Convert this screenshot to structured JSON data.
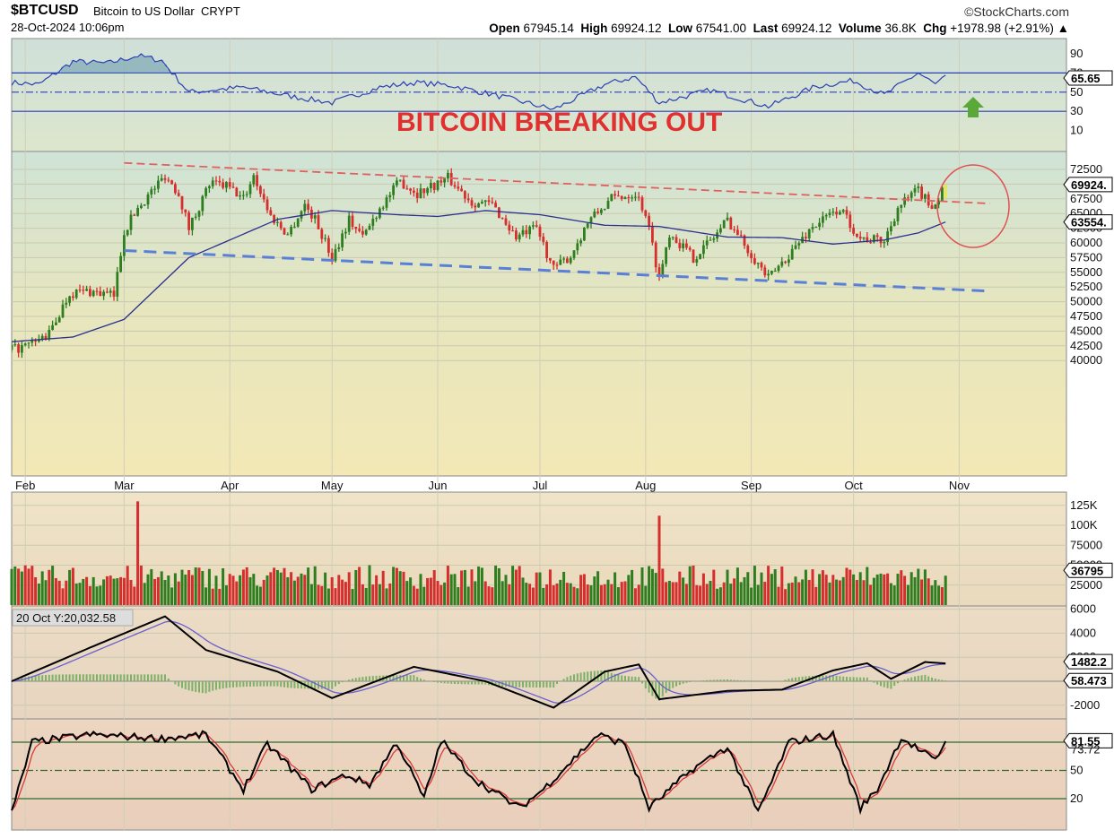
{
  "header": {
    "symbol": "$BTCUSD",
    "name": "Bitcoin to US Dollar",
    "exchange": "CRYPT",
    "datetime": "28-Oct-2024 10:06pm",
    "copyright": "©StockCharts.com",
    "open_label": "Open",
    "open": "67945.14",
    "high_label": "High",
    "high": "69924.12",
    "low_label": "Low",
    "low": "67541.00",
    "last_label": "Last",
    "last": "69924.12",
    "volume_label": "Volume",
    "volume": "36.8K",
    "chg_label": "Chg",
    "chg": "+1978.98 (+2.91%)",
    "chg_arrow": "▲"
  },
  "annotation": "BITCOIN BREAKING OUT",
  "colors": {
    "up": "#2e7d1f",
    "down": "#d62d2d",
    "ma": "#2b2f8f",
    "resistance": "#e06060",
    "support": "#5a7fd6",
    "annotation": "#e03030",
    "circle": "#e05050",
    "arrow": "#5aa83a"
  },
  "months": [
    "Feb",
    "Mar",
    "Apr",
    "May",
    "Jun",
    "Jul",
    "Aug",
    "Sep",
    "Oct",
    "Nov"
  ],
  "rsi_panel": {
    "ticks": [
      "90",
      "70",
      "50",
      "30",
      "10"
    ],
    "value_label": "65.65"
  },
  "price_panel": {
    "ticks": [
      "72500",
      "70000",
      "67500",
      "65000",
      "62500",
      "60000",
      "57500",
      "55000",
      "52500",
      "50000",
      "47500",
      "45000",
      "42500",
      "40000"
    ],
    "last_label": "69924.",
    "ma_label": "63554."
  },
  "volume_panel": {
    "ticks": [
      "125K",
      "100K",
      "75000",
      "50000",
      "25000"
    ],
    "value_label": "36795"
  },
  "macd_panel": {
    "info": "20 Oct Y:20,032.58",
    "ticks": [
      "6000",
      "4000",
      "2000",
      "-2000"
    ],
    "macd_label": "1482.2",
    "hist_label": "58.473"
  },
  "stoch_panel": {
    "ticks": [
      "80",
      "50",
      "20"
    ],
    "k_label": "81.55",
    "d_label": "73.72"
  },
  "chart_data": {
    "type": "line",
    "title": "$BTCUSD Bitcoin to US Dollar CRYPT",
    "x_range": [
      "2024-01-28",
      "2024-10-28"
    ],
    "price_anchors": [
      [
        "2024-01-28",
        41800
      ],
      [
        "2024-02-02",
        42500
      ],
      [
        "2024-02-08",
        44500
      ],
      [
        "2024-02-14",
        51500
      ],
      [
        "2024-02-20",
        51800
      ],
      [
        "2024-02-27",
        51000
      ],
      [
        "2024-03-01",
        62000
      ],
      [
        "2024-03-05",
        66000
      ],
      [
        "2024-03-08",
        68000
      ],
      [
        "2024-03-13",
        71500
      ],
      [
        "2024-03-17",
        68500
      ],
      [
        "2024-03-20",
        62500
      ],
      [
        "2024-03-26",
        70000
      ],
      [
        "2024-03-31",
        69700
      ],
      [
        "2024-04-05",
        67500
      ],
      [
        "2024-04-08",
        71500
      ],
      [
        "2024-04-13",
        64500
      ],
      [
        "2024-04-18",
        61500
      ],
      [
        "2024-04-23",
        66500
      ],
      [
        "2024-04-26",
        64000
      ],
      [
        "2024-05-01",
        57500
      ],
      [
        "2024-05-06",
        64000
      ],
      [
        "2024-05-10",
        61000
      ],
      [
        "2024-05-15",
        66000
      ],
      [
        "2024-05-21",
        70500
      ],
      [
        "2024-05-26",
        68500
      ],
      [
        "2024-06-04",
        71000
      ],
      [
        "2024-06-11",
        67000
      ],
      [
        "2024-06-17",
        66500
      ],
      [
        "2024-06-24",
        61000
      ],
      [
        "2024-06-30",
        62500
      ],
      [
        "2024-07-05",
        55500
      ],
      [
        "2024-07-10",
        57800
      ],
      [
        "2024-07-15",
        63500
      ],
      [
        "2024-07-22",
        67500
      ],
      [
        "2024-07-29",
        68500
      ],
      [
        "2024-08-01",
        65000
      ],
      [
        "2024-08-05",
        54000
      ],
      [
        "2024-08-08",
        61800
      ],
      [
        "2024-08-15",
        57500
      ],
      [
        "2024-08-21",
        61000
      ],
      [
        "2024-08-25",
        64000
      ],
      [
        "2024-08-31",
        59000
      ],
      [
        "2024-09-06",
        53900
      ],
      [
        "2024-09-12",
        58000
      ],
      [
        "2024-09-19",
        62800
      ],
      [
        "2024-09-27",
        65800
      ],
      [
        "2024-10-03",
        60800
      ],
      [
        "2024-10-10",
        60300
      ],
      [
        "2024-10-14",
        66000
      ],
      [
        "2024-10-20",
        69000
      ],
      [
        "2024-10-23",
        66700
      ],
      [
        "2024-10-25",
        66600
      ],
      [
        "2024-10-28",
        69924
      ]
    ],
    "ma_anchors": [
      [
        "2024-01-28",
        43200
      ],
      [
        "2024-02-15",
        44000
      ],
      [
        "2024-03-01",
        47000
      ],
      [
        "2024-03-20",
        57500
      ],
      [
        "2024-04-15",
        64000
      ],
      [
        "2024-05-01",
        65500
      ],
      [
        "2024-05-20",
        64800
      ],
      [
        "2024-06-01",
        64500
      ],
      [
        "2024-06-15",
        65500
      ],
      [
        "2024-07-01",
        64800
      ],
      [
        "2024-07-20",
        63000
      ],
      [
        "2024-08-05",
        62800
      ],
      [
        "2024-08-25",
        61000
      ],
      [
        "2024-09-10",
        60900
      ],
      [
        "2024-09-25",
        59800
      ],
      [
        "2024-10-10",
        60500
      ],
      [
        "2024-10-20",
        61700
      ],
      [
        "2024-10-28",
        63554
      ]
    ],
    "resistance_line": [
      [
        "2024-03-01",
        73600
      ],
      [
        "2024-10-28",
        67500
      ],
      [
        "2024-11-10",
        66700
      ]
    ],
    "support_line": [
      [
        "2024-03-01",
        58700
      ],
      [
        "2024-11-10",
        51800
      ]
    ],
    "rsi_anchors": [
      [
        "2024-01-28",
        60
      ],
      [
        "2024-02-05",
        58
      ],
      [
        "2024-02-15",
        82
      ],
      [
        "2024-02-25",
        80
      ],
      [
        "2024-03-05",
        88
      ],
      [
        "2024-03-12",
        83
      ],
      [
        "2024-03-20",
        50
      ],
      [
        "2024-04-05",
        55
      ],
      [
        "2024-04-20",
        45
      ],
      [
        "2024-05-01",
        39
      ],
      [
        "2024-05-15",
        55
      ],
      [
        "2024-05-25",
        60
      ],
      [
        "2024-06-05",
        57
      ],
      [
        "2024-06-20",
        45
      ],
      [
        "2024-07-05",
        32
      ],
      [
        "2024-07-20",
        58
      ],
      [
        "2024-07-29",
        66
      ],
      [
        "2024-08-05",
        39
      ],
      [
        "2024-08-20",
        52
      ],
      [
        "2024-09-06",
        35
      ],
      [
        "2024-09-20",
        56
      ],
      [
        "2024-10-01",
        62
      ],
      [
        "2024-10-10",
        47
      ],
      [
        "2024-10-20",
        70
      ],
      [
        "2024-10-25",
        58
      ],
      [
        "2024-10-28",
        65.65
      ]
    ],
    "volume_peaks": [
      [
        "2024-03-05",
        130000
      ],
      [
        "2024-08-05",
        112000
      ]
    ],
    "volume_last": 36795,
    "macd_anchors": [
      [
        "2024-01-28",
        0
      ],
      [
        "2024-02-20",
        2800
      ],
      [
        "2024-03-13",
        5400
      ],
      [
        "2024-03-25",
        2600
      ],
      [
        "2024-04-15",
        800
      ],
      [
        "2024-05-01",
        -1400
      ],
      [
        "2024-05-25",
        1200
      ],
      [
        "2024-06-15",
        0
      ],
      [
        "2024-07-05",
        -2200
      ],
      [
        "2024-07-20",
        800
      ],
      [
        "2024-07-30",
        1400
      ],
      [
        "2024-08-05",
        -1500
      ],
      [
        "2024-08-25",
        -800
      ],
      [
        "2024-09-10",
        -700
      ],
      [
        "2024-09-25",
        900
      ],
      [
        "2024-10-05",
        1500
      ],
      [
        "2024-10-12",
        200
      ],
      [
        "2024-10-22",
        1600
      ],
      [
        "2024-10-28",
        1482.2
      ]
    ],
    "stoch_anchors": [
      [
        "2024-01-28",
        5
      ],
      [
        "2024-02-03",
        80
      ],
      [
        "2024-02-20",
        88
      ],
      [
        "2024-03-12",
        84
      ],
      [
        "2024-03-25",
        88
      ],
      [
        "2024-04-05",
        30
      ],
      [
        "2024-04-12",
        78
      ],
      [
        "2024-04-25",
        30
      ],
      [
        "2024-05-05",
        45
      ],
      [
        "2024-05-12",
        35
      ],
      [
        "2024-05-20",
        80
      ],
      [
        "2024-05-28",
        20
      ],
      [
        "2024-06-02",
        82
      ],
      [
        "2024-06-12",
        40
      ],
      [
        "2024-06-25",
        10
      ],
      [
        "2024-07-02",
        30
      ],
      [
        "2024-07-18",
        88
      ],
      [
        "2024-07-26",
        78
      ],
      [
        "2024-08-02",
        10
      ],
      [
        "2024-08-15",
        52
      ],
      [
        "2024-08-25",
        75
      ],
      [
        "2024-09-03",
        5
      ],
      [
        "2024-09-12",
        80
      ],
      [
        "2024-09-25",
        88
      ],
      [
        "2024-10-03",
        10
      ],
      [
        "2024-10-08",
        30
      ],
      [
        "2024-10-15",
        85
      ],
      [
        "2024-10-25",
        60
      ],
      [
        "2024-10-28",
        81.55
      ]
    ]
  }
}
